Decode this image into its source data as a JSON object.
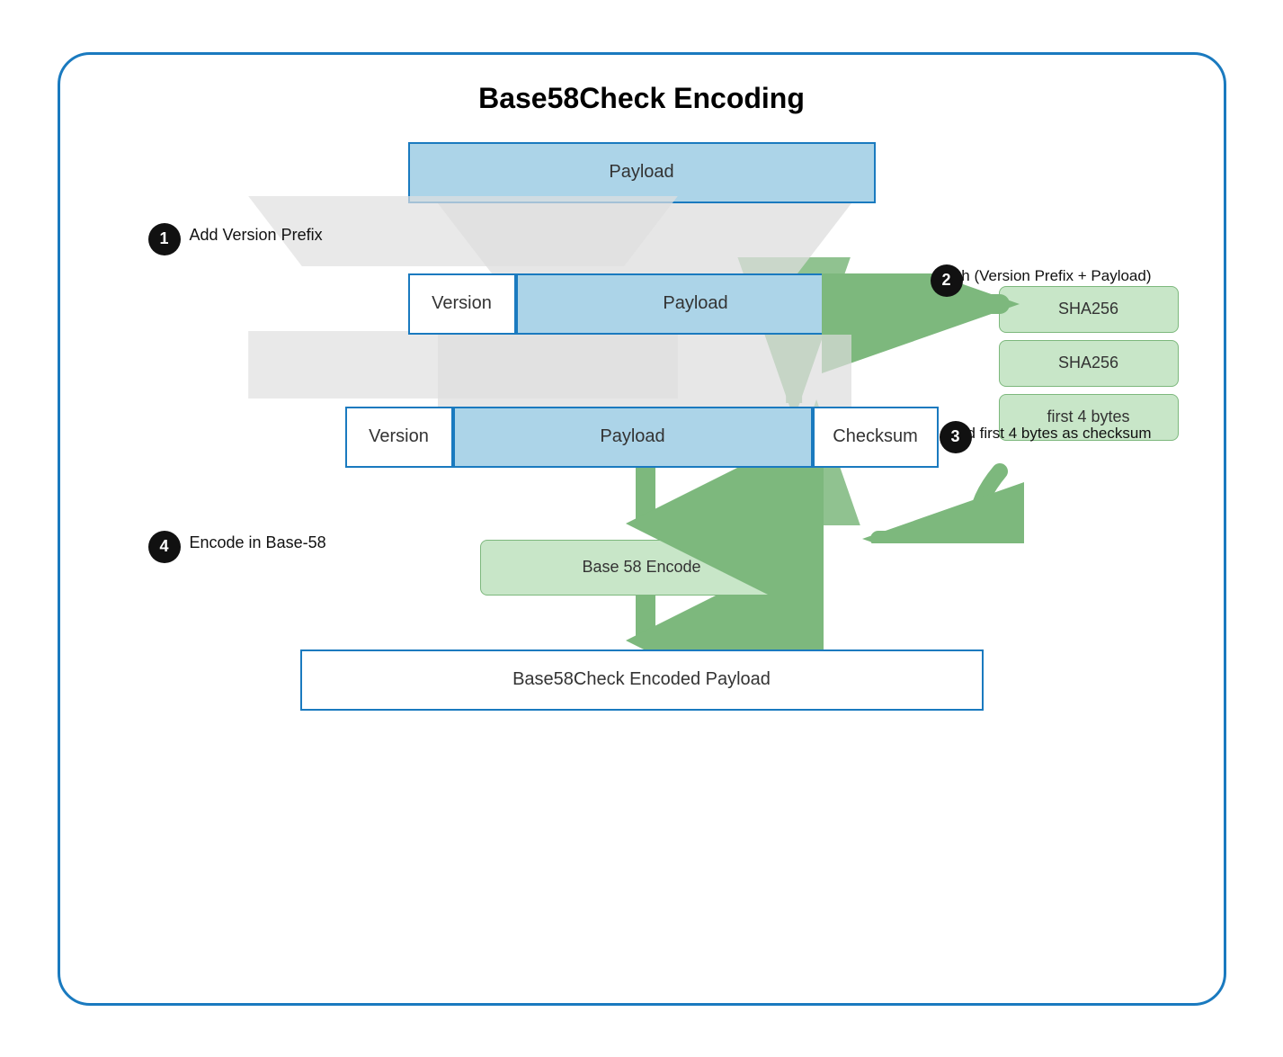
{
  "title": "Base58Check Encoding",
  "steps": [
    {
      "number": "1",
      "label": "Add Version Prefix"
    },
    {
      "number": "2",
      "label": "Hash (Version Prefix + Payload)"
    },
    {
      "number": "3",
      "label": "Add first 4 bytes as checksum"
    },
    {
      "number": "4",
      "label": "Encode in Base-58"
    }
  ],
  "boxes": {
    "payload_top": "Payload",
    "version1": "Version",
    "payload_mid": "Payload",
    "version2": "Version",
    "payload_bot": "Payload",
    "checksum": "Checksum",
    "sha256_1": "SHA256",
    "sha256_2": "SHA256",
    "first4bytes": "first 4 bytes",
    "base58_encode": "Base 58 Encode",
    "final": "Base58Check Encoded Payload"
  }
}
